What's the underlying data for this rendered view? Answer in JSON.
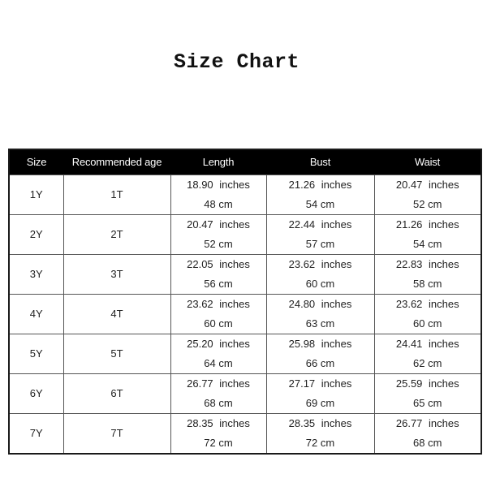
{
  "title": "Size Chart",
  "table": {
    "headers": [
      "Size",
      "Recommended age",
      "Length",
      "Bust",
      "Waist"
    ],
    "rows": [
      {
        "size": "1Y",
        "age": "1T",
        "length": {
          "in": "18.90 inches",
          "cm": "48 cm"
        },
        "bust": {
          "in": "21.26 inches",
          "cm": "54 cm"
        },
        "waist": {
          "in": "20.47 inches",
          "cm": "52 cm"
        }
      },
      {
        "size": "2Y",
        "age": "2T",
        "length": {
          "in": "20.47 inches",
          "cm": "52 cm"
        },
        "bust": {
          "in": "22.44 inches",
          "cm": "57 cm"
        },
        "waist": {
          "in": "21.26 inches",
          "cm": "54 cm"
        }
      },
      {
        "size": "3Y",
        "age": "3T",
        "length": {
          "in": "22.05 inches",
          "cm": "56 cm"
        },
        "bust": {
          "in": "23.62 inches",
          "cm": "60 cm"
        },
        "waist": {
          "in": "22.83 inches",
          "cm": "58 cm"
        }
      },
      {
        "size": "4Y",
        "age": "4T",
        "length": {
          "in": "23.62 inches",
          "cm": "60 cm"
        },
        "bust": {
          "in": "24.80 inches",
          "cm": "63 cm"
        },
        "waist": {
          "in": "23.62 inches",
          "cm": "60 cm"
        }
      },
      {
        "size": "5Y",
        "age": "5T",
        "length": {
          "in": "25.20 inches",
          "cm": "64 cm"
        },
        "bust": {
          "in": "25.98 inches",
          "cm": "66 cm"
        },
        "waist": {
          "in": "24.41 inches",
          "cm": "62 cm"
        }
      },
      {
        "size": "6Y",
        "age": "6T",
        "length": {
          "in": "26.77 inches",
          "cm": "68 cm"
        },
        "bust": {
          "in": "27.17 inches",
          "cm": "69 cm"
        },
        "waist": {
          "in": "25.59 inches",
          "cm": "65 cm"
        }
      },
      {
        "size": "7Y",
        "age": "7T",
        "length": {
          "in": "28.35 inches",
          "cm": "72 cm"
        },
        "bust": {
          "in": "28.35 inches",
          "cm": "72 cm"
        },
        "waist": {
          "in": "26.77 inches",
          "cm": "68 cm"
        }
      }
    ]
  },
  "colors": {
    "header_bg": "#000000",
    "header_text": "#ffffff",
    "border": "#555555",
    "text": "#222222"
  }
}
